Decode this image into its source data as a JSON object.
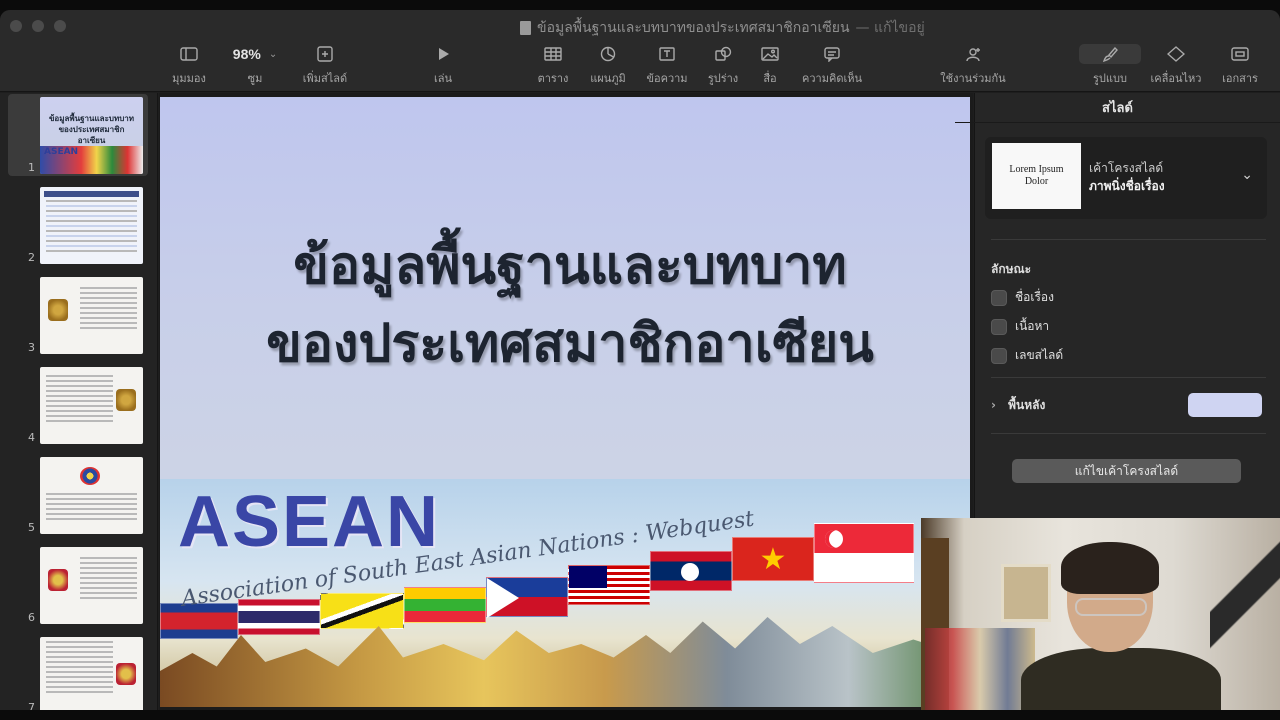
{
  "window": {
    "title": "ข้อมูลพื้นฐานและบทบาทของประเทศสมาชิกอาเซียน",
    "title_suffix": "— แก้ไขอยู่"
  },
  "toolbar": {
    "view_label": "มุมมอง",
    "zoom_value": "98%",
    "zoom_label": "ซูม",
    "add_slide_label": "เพิ่มสไลด์",
    "play_label": "เล่น",
    "table_label": "ตาราง",
    "chart_label": "แผนภูมิ",
    "text_label": "ข้อความ",
    "shape_label": "รูปร่าง",
    "media_label": "สื่อ",
    "comment_label": "ความคิดเห็น",
    "collaborate_label": "ใช้งานร่วมกัน",
    "format_label": "รูปแบบ",
    "animate_label": "เคลื่อนไหว",
    "document_label": "เอกสาร"
  },
  "navigator": {
    "slides": [
      {
        "num": "1",
        "title": "ข้อมูลพื้นฐานและบทบาทของประเทศสมาชิกอาเซียน",
        "badge": "ASEAN"
      },
      {
        "num": "2"
      },
      {
        "num": "3"
      },
      {
        "num": "4"
      },
      {
        "num": "5"
      },
      {
        "num": "6"
      },
      {
        "num": "7"
      }
    ]
  },
  "slide": {
    "title_line1": "ข้อมูลพื้นฐานและบทบาท",
    "title_line2": "ของประเทศสมาชิกอาเซียน",
    "banner_word": "ASEAN",
    "banner_subtitle": "Association of South East Asian Nations : Webquest"
  },
  "inspector": {
    "header": "สไลด์",
    "layout_preview_line1": "Lorem Ipsum",
    "layout_preview_line2": "Dolor",
    "layout_label": "เค้าโครงสไลด์",
    "layout_value": "ภาพนิ่งชื่อเรื่อง",
    "appearance_label": "ลักษณะ",
    "checkbox_title": "ชื่อเรื่อง",
    "checkbox_body": "เนื้อหา",
    "checkbox_slide_number": "เลขสไลด์",
    "background_label": "พื้นหลัง",
    "background_color": "#cfd4f2",
    "edit_layout_button": "แก้ไขเค้าโครงสไลด์"
  }
}
